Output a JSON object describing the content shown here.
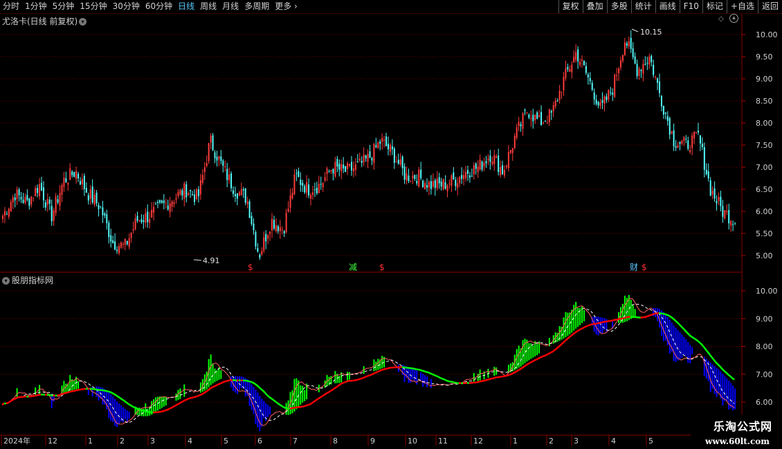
{
  "toolbar": {
    "periods": [
      "分时",
      "1分钟",
      "5分钟",
      "15分钟",
      "30分钟",
      "60分钟",
      "日线",
      "周线",
      "月线",
      "多周期",
      "更多"
    ],
    "active_period": "日线",
    "buttons": [
      "复权",
      "叠加",
      "多股",
      "统计",
      "画线",
      "F10",
      "标记",
      "+自选",
      "返回"
    ]
  },
  "main_panel": {
    "title": "尤洛卡(日线 前复权)",
    "y_axis_labels": [
      "10.00",
      "9.50",
      "9.00",
      "8.50",
      "8.00",
      "7.50",
      "7.00",
      "6.50",
      "6.00",
      "5.50",
      "5.00"
    ],
    "y_axis_values": [
      10.0,
      9.5,
      9.0,
      8.5,
      8.0,
      7.5,
      7.0,
      6.5,
      6.0,
      5.5,
      5.0
    ],
    "high_marker": "10.15",
    "low_marker": "4.91",
    "event_markers": [
      "$",
      "减",
      "$",
      "财",
      "$"
    ],
    "up_color": "#ff3c3c",
    "down_color": "#54fcfc"
  },
  "indicator_panel": {
    "title": "股朋指标网",
    "y_axis_labels": [
      "10.00",
      "9.00",
      "8.00",
      "7.00",
      "6.00"
    ],
    "y_axis_values": [
      10.0,
      9.0,
      8.0,
      7.0,
      6.0
    ],
    "colors": {
      "green": "#00ff00",
      "blue": "#0000ff",
      "red": "#ff0000",
      "white": "#ffffff"
    }
  },
  "time_axis": {
    "labels": [
      "2024年",
      "12",
      "1",
      "2",
      "3",
      "4",
      "5",
      "6",
      "7",
      "8",
      "9",
      "10",
      "11",
      "12",
      "1",
      "2",
      "3",
      "4",
      "5"
    ]
  },
  "watermark": {
    "line1": "乐淘公式网",
    "line2": "www.60lt.com"
  },
  "chart_data": {
    "type": "line",
    "title": "尤洛卡(日线 前复权)",
    "series": [
      {
        "name": "",
        "values": [
          5.9,
          6.4,
          6.2,
          6.6,
          5.9,
          6.7,
          6.9,
          6.4,
          6.1,
          5.3,
          5.2,
          5.8,
          5.9,
          6.1,
          6.3,
          6.5,
          6.3,
          7.6,
          7.0,
          6.5,
          6.3,
          5.0,
          5.8,
          5.6,
          6.8,
          6.5,
          6.6,
          7.0,
          6.9,
          7.0,
          7.2,
          7.6,
          7.3,
          6.8,
          6.8,
          6.6,
          6.6,
          6.7,
          6.9,
          7.0,
          7.3,
          6.9,
          7.7,
          8.3,
          8.0,
          8.2,
          9.0,
          9.6,
          9.0,
          8.3,
          8.8,
          9.9,
          9.2,
          9.5,
          8.5,
          7.6,
          7.5,
          7.7,
          6.5,
          6.0,
          5.8
        ]
      }
    ],
    "ylim": [
      4.8,
      10.4
    ]
  }
}
